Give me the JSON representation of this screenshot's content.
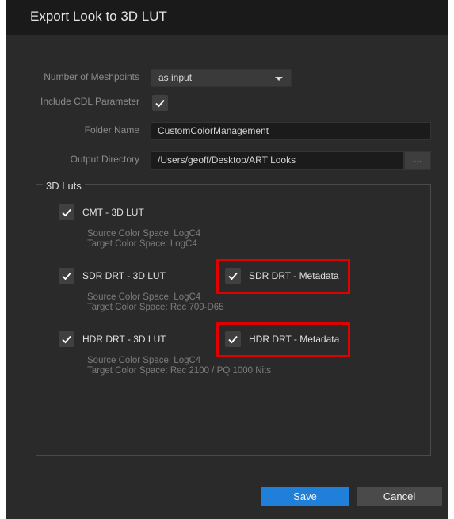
{
  "dialog": {
    "title": "Export Look to 3D LUT"
  },
  "form": {
    "meshpoints_label": "Number of Meshpoints",
    "meshpoints_value": "as input",
    "cdl_label": "Include CDL Parameter",
    "cdl_checked": true,
    "folder_label": "Folder Name",
    "folder_value": "CustomColorManagement",
    "output_label": "Output Directory",
    "output_value": "/Users/geoff/Desktop/ART Looks",
    "browse_label": "..."
  },
  "luts": {
    "group_title": "3D Luts",
    "items": [
      {
        "label": "CMT - 3D LUT",
        "checked": true,
        "source": "Source Color Space: LogC4",
        "target": "Target Color Space: LogC4"
      },
      {
        "label": "SDR DRT - 3D LUT",
        "checked": true,
        "metadata_label": "SDR DRT - Metadata",
        "metadata_checked": true,
        "source": "Source Color Space: LogC4",
        "target": "Target Color Space: Rec 709-D65"
      },
      {
        "label": "HDR DRT - 3D LUT",
        "checked": true,
        "metadata_label": "HDR DRT - Metadata",
        "metadata_checked": true,
        "source": "Source Color Space: LogC4",
        "target": "Target Color Space: Rec 2100 / PQ 1000 Nits"
      }
    ]
  },
  "buttons": {
    "save": "Save",
    "cancel": "Cancel"
  },
  "colors": {
    "background": "#2a2a2a",
    "titlebar": "#1a1a1a",
    "accent": "#1f7fd9",
    "highlight": "#e00000"
  }
}
